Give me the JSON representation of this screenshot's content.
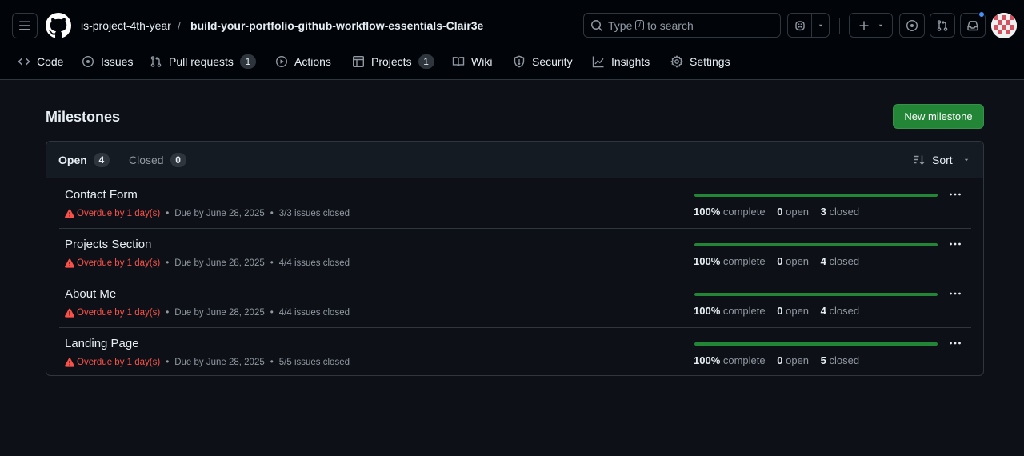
{
  "header": {
    "owner": "is-project-4th-year",
    "separator": "/",
    "repo": "build-your-portfolio-github-workflow-essentials-Clair3e",
    "search": {
      "prefix": "Type",
      "key": "/",
      "suffix": "to search"
    }
  },
  "nav": [
    {
      "label": "Code",
      "icon": "code-icon"
    },
    {
      "label": "Issues",
      "icon": "issue-opened-icon"
    },
    {
      "label": "Pull requests",
      "icon": "git-pull-request-icon",
      "count": "1"
    },
    {
      "label": "Actions",
      "icon": "play-icon"
    },
    {
      "label": "Projects",
      "icon": "table-icon",
      "count": "1"
    },
    {
      "label": "Wiki",
      "icon": "book-icon"
    },
    {
      "label": "Security",
      "icon": "shield-icon"
    },
    {
      "label": "Insights",
      "icon": "graph-icon"
    },
    {
      "label": "Settings",
      "icon": "gear-icon"
    }
  ],
  "page": {
    "title": "Milestones",
    "new_button": "New milestone"
  },
  "filters": {
    "open_label": "Open",
    "open_count": "4",
    "closed_label": "Closed",
    "closed_count": "0",
    "sort_label": "Sort"
  },
  "milestones": [
    {
      "title": "Contact Form",
      "overdue": "Overdue by 1 day(s)",
      "due": "Due by June 28, 2025",
      "issues": "3/3 issues closed",
      "percent": "100%",
      "complete_label": "complete",
      "open": "0",
      "open_label": "open",
      "closed": "3",
      "closed_label": "closed",
      "progress": 1.0
    },
    {
      "title": "Projects Section",
      "overdue": "Overdue by 1 day(s)",
      "due": "Due by June 28, 2025",
      "issues": "4/4 issues closed",
      "percent": "100%",
      "complete_label": "complete",
      "open": "0",
      "open_label": "open",
      "closed": "4",
      "closed_label": "closed",
      "progress": 1.0
    },
    {
      "title": "About Me",
      "overdue": "Overdue by 1 day(s)",
      "due": "Due by June 28, 2025",
      "issues": "4/4 issues closed",
      "percent": "100%",
      "complete_label": "complete",
      "open": "0",
      "open_label": "open",
      "closed": "4",
      "closed_label": "closed",
      "progress": 1.0
    },
    {
      "title": "Landing Page",
      "overdue": "Overdue by 1 day(s)",
      "due": "Due by June 28, 2025",
      "issues": "5/5 issues closed",
      "percent": "100%",
      "complete_label": "complete",
      "open": "0",
      "open_label": "open",
      "closed": "5",
      "closed_label": "closed",
      "progress": 1.0
    }
  ],
  "colors": {
    "background": "#0d1117",
    "accent_green": "#238636",
    "danger": "#f85149",
    "notification": "#4493f8"
  }
}
